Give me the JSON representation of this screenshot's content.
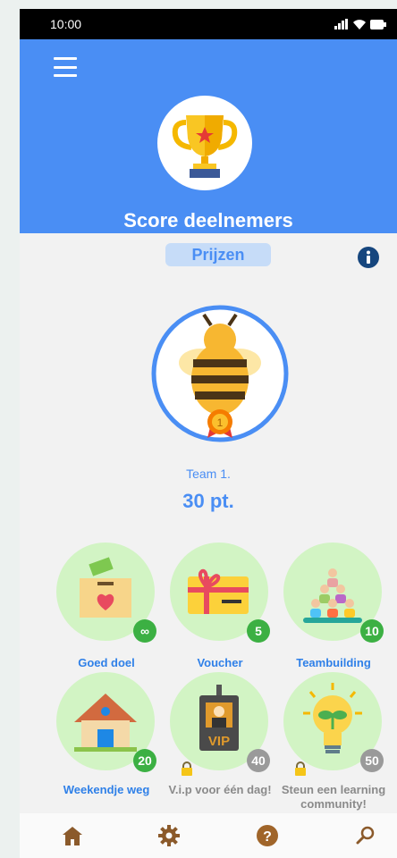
{
  "status_bar": {
    "time": "10:00"
  },
  "header": {
    "title": "Score deelnemers"
  },
  "tabs": {
    "active_label": "Prijzen"
  },
  "team": {
    "name": "Team 1.",
    "score": "30 pt."
  },
  "prizes": [
    {
      "label": "Goed doel",
      "points": "∞",
      "locked": false
    },
    {
      "label": "Voucher",
      "points": "5",
      "locked": false
    },
    {
      "label": "Teambuilding",
      "points": "10",
      "locked": false
    },
    {
      "label": "Weekendje weg",
      "points": "20",
      "locked": false
    },
    {
      "label": "V.i.p voor één dag!",
      "points": "40",
      "locked": true
    },
    {
      "label": "Steun een learning community!",
      "points": "50",
      "locked": true
    }
  ],
  "colors": {
    "accent": "#4a8ef4",
    "prize_bg": "#d2f4c4",
    "badge_green": "#3cb043",
    "badge_grey": "#9a9a9a"
  },
  "icons": {
    "menu": "hamburger-menu-icon",
    "info": "info-icon",
    "nav": [
      "home-icon",
      "gear-icon",
      "help-icon",
      "search-icon"
    ]
  }
}
